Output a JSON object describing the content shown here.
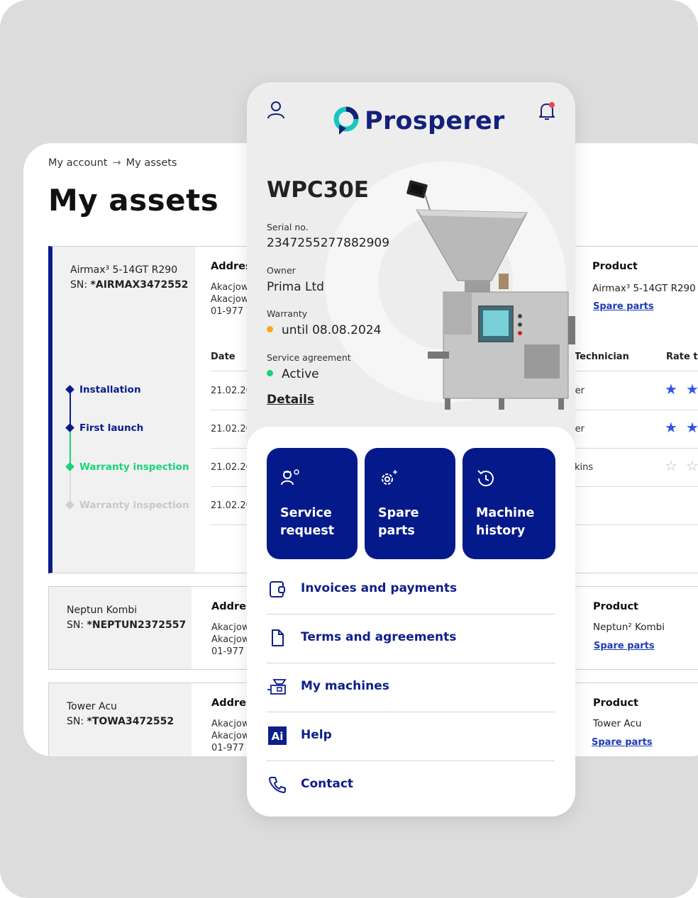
{
  "breadcrumb": {
    "account": "My account",
    "arrow": "→",
    "current": "My assets"
  },
  "page_title": "My assets",
  "columns": {
    "address": "Address",
    "product": "Product",
    "date": "Date",
    "technician": "Technician",
    "rate": "Rate the"
  },
  "assets": [
    {
      "name": "Airmax³ 5-14GT R290",
      "sn_prefix": "SN: ",
      "sn": "*AIRMAX3472552",
      "address": [
        "Akacjowa",
        "Akacjowa",
        "01-977 W"
      ],
      "product": "Airmax³ 5-14GT R290",
      "spare": "Spare parts",
      "timeline": [
        {
          "label": "Installation",
          "date": "21.02.2024",
          "tech": "Müller",
          "rating": 2,
          "state": "done"
        },
        {
          "label": "First launch",
          "date": "21.02.2024",
          "tech": "Müller",
          "rating": 2,
          "state": "done"
        },
        {
          "label": "Warranty inspection",
          "date": "21.02.2024",
          "tech": "Hopkins",
          "rating": 0,
          "state": "current"
        },
        {
          "label": "Warranty inspection",
          "date": "21.02.2024",
          "tech": "",
          "rating": 0,
          "state": "upcoming"
        }
      ]
    },
    {
      "name": "Neptun Kombi",
      "sn_prefix": "SN: ",
      "sn": "*NEPTUN2372557",
      "address": [
        "Akacjowa",
        "Akacjowa",
        "01-977 W"
      ],
      "product": "Neptun² Kombi",
      "spare": "Spare parts"
    },
    {
      "name": "Tower Acu",
      "sn_prefix": "SN: ",
      "sn": "*TOWA3472552",
      "address": [
        "Akacjowa",
        "Akacjowa",
        "01-977 W"
      ],
      "product": "Tower Acu",
      "spare": "Spare parts"
    }
  ],
  "colors": {
    "navy": "#041a8a",
    "brand_dark": "#14217a",
    "teal": "#16c7c0",
    "green": "#19d37a",
    "orange": "#f5a623",
    "notif": "#e8455b"
  },
  "phone": {
    "brand": "Prosperer",
    "model": "WPC30E",
    "serial_label": "Serial no.",
    "serial": "2347255277882909",
    "owner_label": "Owner",
    "owner": "Prima Ltd",
    "warranty_label": "Warranty",
    "warranty": "until 08.08.2024",
    "agreement_label": "Service agreement",
    "agreement": "Active",
    "details": "Details",
    "tiles": [
      {
        "label": "Service request",
        "icon": "technician-gear-icon"
      },
      {
        "label": "Spare parts",
        "icon": "gear-sparkle-icon"
      },
      {
        "label": "Machine history",
        "icon": "history-icon"
      }
    ],
    "menu": [
      {
        "label": "Invoices and payments",
        "icon": "wallet-icon"
      },
      {
        "label": "Terms and agreements",
        "icon": "document-icon"
      },
      {
        "label": "My machines",
        "icon": "machine-icon"
      },
      {
        "label": "Help",
        "icon": "ai-help-icon"
      },
      {
        "label": "Contact",
        "icon": "phone-icon"
      }
    ]
  }
}
